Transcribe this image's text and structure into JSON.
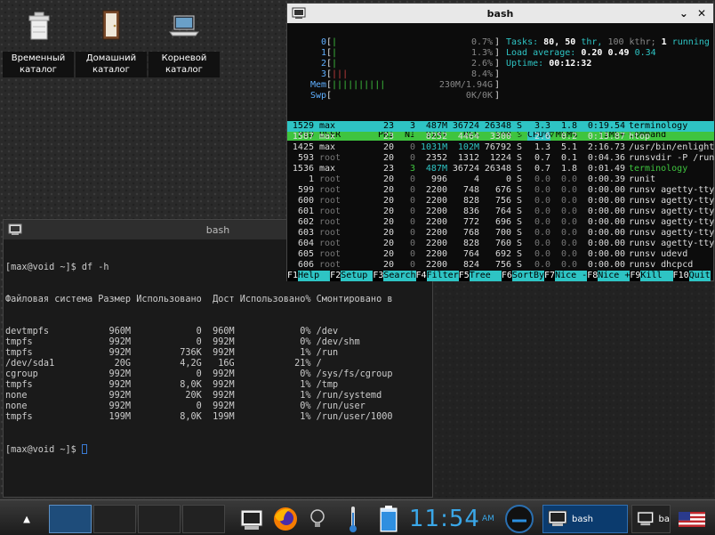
{
  "desktop": {
    "icons": [
      {
        "name": "trash",
        "label": "Временный\nкаталог"
      },
      {
        "name": "home",
        "label": "Домашний\nкаталог"
      },
      {
        "name": "root",
        "label": "Корневой\nкаталог"
      }
    ]
  },
  "htop_window": {
    "title": "bash",
    "meters": {
      "cpus": [
        {
          "label": "0",
          "pct_text": "0.7%",
          "bars": "|"
        },
        {
          "label": "1",
          "pct_text": "1.3%",
          "bars": "|"
        },
        {
          "label": "2",
          "pct_text": "2.6%",
          "bars": "|"
        },
        {
          "label": "3",
          "pct_text": "8.4%",
          "bars": "|||"
        }
      ],
      "mem": {
        "label": "Mem",
        "bars": "||||||||||",
        "text": "230M/1.94G"
      },
      "swp": {
        "label": "Swp",
        "text": "0K/0K"
      }
    },
    "stats": {
      "tasks_label": "Tasks:",
      "tasks": "80,",
      "thr": "50",
      "thr_label": "thr,",
      "kthr": "100 kthr;",
      "running": "1",
      "running_label": "running",
      "load_label": "Load average:",
      "load1": "0.20",
      "load5": "0.49",
      "load15": "0.34",
      "uptime_label": "Uptime:",
      "uptime": "00:12:32"
    },
    "columns": [
      "PID",
      "USER",
      "PRI",
      "NI",
      "VIRT",
      "RES",
      "SHR",
      "S",
      "CPU%▽",
      "MEM%",
      "TIME+",
      "Command"
    ],
    "processes": [
      {
        "pid": "1529",
        "user": "max",
        "pri": "23",
        "ni": "3",
        "virt": "487M",
        "res": "36724",
        "shr": "26348",
        "s": "S",
        "cpu": "3.3",
        "mem": "1.8",
        "time": "0:19.54",
        "cmd": "terminology",
        "selected": true
      },
      {
        "pid": "1587",
        "user": "max",
        "pri": "23",
        "ni": "3",
        "virt": "8252",
        "res": "4464",
        "shr": "3300",
        "s": "R",
        "cpu": "2.6",
        "mem": "0.2",
        "time": "0:13.87",
        "cmd": "htop"
      },
      {
        "pid": "1425",
        "user": "max",
        "pri": "20",
        "ni": "0",
        "virt": "1031M",
        "res": "102M",
        "shr": "76792",
        "s": "S",
        "cpu": "1.3",
        "mem": "5.1",
        "time": "2:16.73",
        "cmd": "/usr/bin/enlight"
      },
      {
        "pid": "593",
        "user": "root",
        "pri": "20",
        "ni": "0",
        "virt": "2352",
        "res": "1312",
        "shr": "1224",
        "s": "S",
        "cpu": "0.7",
        "mem": "0.1",
        "time": "0:04.36",
        "cmd": "runsvdir -P /run"
      },
      {
        "pid": "1536",
        "user": "max",
        "pri": "23",
        "ni": "3",
        "virt": "487M",
        "res": "36724",
        "shr": "26348",
        "s": "S",
        "cpu": "0.7",
        "mem": "1.8",
        "time": "0:01.49",
        "cmd": "terminology"
      },
      {
        "pid": "1",
        "user": "root",
        "pri": "20",
        "ni": "0",
        "virt": "996",
        "res": "4",
        "shr": "0",
        "s": "S",
        "cpu": "0.0",
        "mem": "0.0",
        "time": "0:00.39",
        "cmd": "runit"
      },
      {
        "pid": "599",
        "user": "root",
        "pri": "20",
        "ni": "0",
        "virt": "2200",
        "res": "748",
        "shr": "676",
        "s": "S",
        "cpu": "0.0",
        "mem": "0.0",
        "time": "0:00.00",
        "cmd": "runsv agetty-tty"
      },
      {
        "pid": "600",
        "user": "root",
        "pri": "20",
        "ni": "0",
        "virt": "2200",
        "res": "828",
        "shr": "756",
        "s": "S",
        "cpu": "0.0",
        "mem": "0.0",
        "time": "0:00.00",
        "cmd": "runsv agetty-tty"
      },
      {
        "pid": "601",
        "user": "root",
        "pri": "20",
        "ni": "0",
        "virt": "2200",
        "res": "836",
        "shr": "764",
        "s": "S",
        "cpu": "0.0",
        "mem": "0.0",
        "time": "0:00.00",
        "cmd": "runsv agetty-tty"
      },
      {
        "pid": "602",
        "user": "root",
        "pri": "20",
        "ni": "0",
        "virt": "2200",
        "res": "772",
        "shr": "696",
        "s": "S",
        "cpu": "0.0",
        "mem": "0.0",
        "time": "0:00.00",
        "cmd": "runsv agetty-tty"
      },
      {
        "pid": "603",
        "user": "root",
        "pri": "20",
        "ni": "0",
        "virt": "2200",
        "res": "768",
        "shr": "700",
        "s": "S",
        "cpu": "0.0",
        "mem": "0.0",
        "time": "0:00.00",
        "cmd": "runsv agetty-tty"
      },
      {
        "pid": "604",
        "user": "root",
        "pri": "20",
        "ni": "0",
        "virt": "2200",
        "res": "828",
        "shr": "760",
        "s": "S",
        "cpu": "0.0",
        "mem": "0.0",
        "time": "0:00.00",
        "cmd": "runsv agetty-tty"
      },
      {
        "pid": "605",
        "user": "root",
        "pri": "20",
        "ni": "0",
        "virt": "2200",
        "res": "764",
        "shr": "692",
        "s": "S",
        "cpu": "0.0",
        "mem": "0.0",
        "time": "0:00.00",
        "cmd": "runsv udevd"
      },
      {
        "pid": "606",
        "user": "root",
        "pri": "20",
        "ni": "0",
        "virt": "2200",
        "res": "824",
        "shr": "756",
        "s": "S",
        "cpu": "0.0",
        "mem": "0.0",
        "time": "0:00.00",
        "cmd": "runsv dhcpcd"
      }
    ],
    "fkeys": [
      {
        "k": "F1",
        "v": "Help  "
      },
      {
        "k": "F2",
        "v": "Setup "
      },
      {
        "k": "F3",
        "v": "Search"
      },
      {
        "k": "F4",
        "v": "Filter"
      },
      {
        "k": "F5",
        "v": "Tree  "
      },
      {
        "k": "F6",
        "v": "SortBy"
      },
      {
        "k": "F7",
        "v": "Nice -"
      },
      {
        "k": "F8",
        "v": "Nice +"
      },
      {
        "k": "F9",
        "v": "Kill  "
      },
      {
        "k": "F10",
        "v": "Quit"
      }
    ]
  },
  "df_window": {
    "title": "bash",
    "prompt1": "[max@void ~]$ df -h",
    "header": "Файловая система Размер Использовано  Дост Использовано% Cмонтировано в",
    "rows": [
      "devtmpfs           960M            0  960M            0% /dev",
      "tmpfs              992M            0  992M            0% /dev/shm",
      "tmpfs              992M         736K  992M            1% /run",
      "/dev/sda1           20G         4,2G   16G           21% /",
      "cgroup             992M            0  992M            0% /sys/fs/cgroup",
      "tmpfs              992M         8,0K  992M            1% /tmp",
      "none               992M          20K  992M            1% /run/systemd",
      "none               992M            0  992M            0% /run/user",
      "tmpfs              199M         8,0K  199M            1% /run/user/1000"
    ],
    "prompt2": "[max@void ~]$ "
  },
  "taskbar": {
    "clock_hm": "11:54",
    "clock_ampm": "AM",
    "tasks": [
      {
        "label": "bash",
        "active": true
      },
      {
        "label": "ba",
        "active": false
      }
    ],
    "colors": {
      "accent": "#3aa7e8",
      "htop_green": "#3fc43f",
      "htop_cyan": "#2ec4c4"
    }
  }
}
